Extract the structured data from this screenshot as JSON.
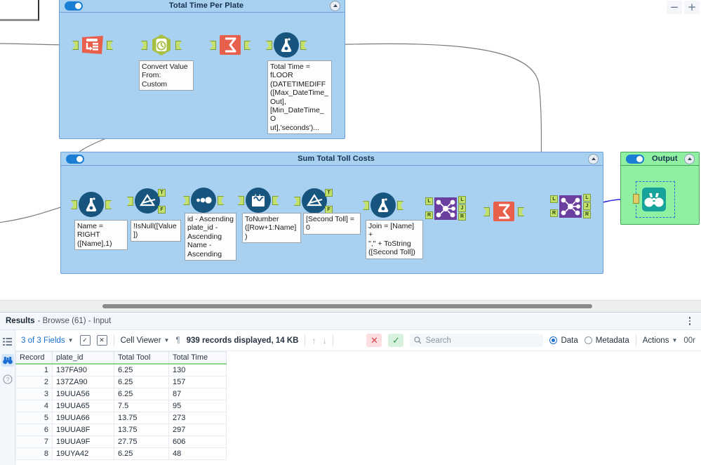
{
  "canvas": {
    "zoom_out_label": "−",
    "zoom_in_label": "+",
    "containers": [
      {
        "id": "total-time-per-plate",
        "title": "Total Time Per Plate",
        "toggle_on": true
      },
      {
        "id": "sum-total-toll-costs",
        "title": "Sum Total Toll Costs",
        "toggle_on": true
      },
      {
        "id": "output",
        "title": "Output",
        "toggle_on": true
      }
    ],
    "tools": [
      {
        "name": "input-data-tool",
        "icon": "input-data-icon"
      },
      {
        "name": "datetime-tool",
        "icon": "clock-icon"
      },
      {
        "name": "summarize-tool",
        "icon": "sigma-icon"
      },
      {
        "name": "formula-tool",
        "icon": "flask-icon"
      },
      {
        "name": "formula-tool-2",
        "icon": "flask-icon"
      },
      {
        "name": "filter-tool",
        "icon": "filter-icon"
      },
      {
        "name": "sort-tool",
        "icon": "sort-icon"
      },
      {
        "name": "multi-row-formula-tool",
        "icon": "multi-row-formula-icon"
      },
      {
        "name": "filter-tool-2",
        "icon": "filter-icon"
      },
      {
        "name": "formula-tool-3",
        "icon": "flask-icon"
      },
      {
        "name": "join-tool",
        "icon": "join-icon"
      },
      {
        "name": "summarize-tool-2",
        "icon": "sigma-icon"
      },
      {
        "name": "join-tool-2",
        "icon": "join-icon"
      },
      {
        "name": "browse-tool",
        "icon": "binoculars-icon"
      }
    ],
    "annotations": {
      "convert_value": "Convert Value\nFrom:\nCustom",
      "total_time": "Total Time =\nfLOOR\n(DATETIMEDIFF\n([Max_DateTime_\nOut],\n[Min_DateTime_O\nut],'seconds')...",
      "name_right": "Name = RIGHT\n([Name],1)",
      "is_not_null": "!IsNull([Value])",
      "sort_spec": "id - Ascending\nplate_id -\nAscending\nName -\nAscending",
      "to_number": "ToNumber\n([Row+1:Name])",
      "second_toll": "[Second Toll] = 0",
      "join_formula": "Join = [Name] +\n\",\" + ToString\n([Second Toll])"
    },
    "port_labels": {
      "t": "T",
      "f": "F",
      "l": "L",
      "j": "J",
      "r": "R"
    }
  },
  "results": {
    "title": "Results",
    "subtitle": "- Browse (61) - Input",
    "rail": [
      {
        "name": "list-view-icon",
        "glyph": "☰"
      },
      {
        "name": "browse-icon",
        "glyph": "👓"
      },
      {
        "name": "help-icon",
        "glyph": "?"
      }
    ],
    "toolbar": {
      "fields_label": "3 of 3 Fields",
      "select_all_icon": "checkbox-icon",
      "deselect_icon": "deselect-icon",
      "cell_viewer_label": "Cell Viewer",
      "pilcrow_icon": "¶",
      "records_label": "939 records displayed, 14 KB",
      "up_arrow": "↑",
      "down_arrow": "↓",
      "reject_icon": "✕",
      "accept_icon": "✓",
      "search_placeholder": "Search",
      "data_label": "Data",
      "metadata_label": "Metadata",
      "data_selected": true,
      "actions_label": "Actions",
      "truncated_label": "00r"
    },
    "table": {
      "columns": [
        "Record",
        "plate_id",
        "Total Tool",
        "Total Time"
      ],
      "rows": [
        [
          "1",
          "137FA90",
          "6.25",
          "130"
        ],
        [
          "2",
          "137ZA90",
          "6.25",
          "157"
        ],
        [
          "3",
          "19UUA56",
          "6.25",
          "87"
        ],
        [
          "4",
          "19UUA65",
          "7.5",
          "95"
        ],
        [
          "5",
          "19UUA66",
          "13.75",
          "273"
        ],
        [
          "6",
          "19UUA8F",
          "13.75",
          "297"
        ],
        [
          "7",
          "19UUA9F",
          "27.75",
          "606"
        ],
        [
          "8",
          "19UYA42",
          "6.25",
          "48"
        ]
      ]
    }
  },
  "colors": {
    "container_blue": "#a8d0f0",
    "container_green": "#8ef0a0",
    "tool_red": "#e8604c",
    "tool_blue": "#17557f",
    "tool_purple": "#6b3fa0",
    "tool_teal": "#18a39a",
    "accent_link": "#1a6fd4"
  }
}
